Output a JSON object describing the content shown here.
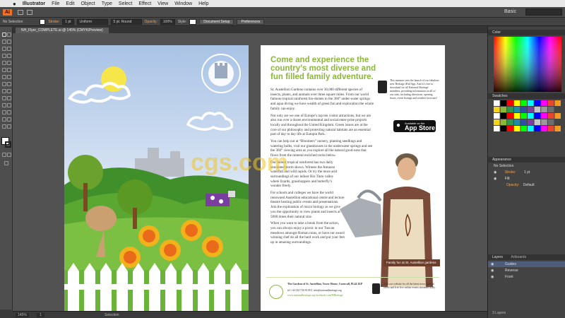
{
  "menu": {
    "app": "Illustrator",
    "items": [
      "File",
      "Edit",
      "Object",
      "Type",
      "Select",
      "Effect",
      "View",
      "Window",
      "Help"
    ]
  },
  "appbar": {
    "logo": "Ai",
    "workspace": "Basic"
  },
  "control": {
    "selection": "No Selection",
    "stroke_label": "Stroke:",
    "stroke_value": "1 pt",
    "stroke_style": "Uniform",
    "brush": "5 pt. Round",
    "opacity_label": "Opacity:",
    "opacity_value": "100%",
    "style_label": "Style:",
    "doc_setup": "Document Setup",
    "prefs": "Preferences"
  },
  "document": {
    "tab_title": "NH_Flyer_COMPLETE.ai @ 145% (CMYK/Preview)"
  },
  "flyer": {
    "headline": "Come and experience the country’s most diverse and fun filled family adventure.",
    "para1": "St. Austellion Gardens contains over 30,000 different species of insects, plants, and animals over three square miles. From our world famous tropical rainforest bio-domes to the 360° under-water springs and aqua diving we have wealth of green fun and exploration the whole family can enjoy.",
    "para2": "Not only are we one of Europe’s top ten visitor attractions, but we are also run over a dozen environmental and social enter-prise projects locally and throughout the United Kingdom. Green issues are at the core of our philosophy and protecting natural habitats are an essential part of day to day life at Eutopia Park.",
    "para3": "You can help out at “Bloomers” nursery, planting seedlings and watering bulbs, visit our glasshouses in the underwater springs and see the 360° viewing area as you explore all the natural good-ness that flows from the mineral enriched rocks below.",
    "para4": "Our indoor tropical rainforest has two daily simulated storm shows. Witness the Amazon waterfall and wild rapids. Or try the more arid surroundings of our indoor Rio Tinto valley where lizards, grasshoppers and butterfly’s wonder freely.",
    "para5": "For schools and colleges we have the world renowned Austellion educational centre and lecture theatre hosting public events and presentations. Join the exploration of micro biology as we give you the opportunity to view plants and insects at 5000 times their natural size.",
    "para6": "When you want to take a break from the action, you can always enjoy a picnic in our Tuscan meadows amongst Roman ruins, or have our award winning chef do all the hard work and put your feet up in amazing surroundings.",
    "app_promo": "This summer sees the launch of our fabulous new Heritage iPad App. And it’s free to download for all National Heritage members, providing information on all of our sites, including directions, opening hours, event listings and weather forecasts!",
    "appstore_small": "Available on the",
    "appstore_big": "App Store",
    "caption": "Family fun at St. Austellion gardens",
    "footer_address": "The Gardens of St. Austellion, Tower House, Cornwall, PL44 3EP",
    "footer_contact": "tel +44 (0)1726 811911  info@nationalheritage.org",
    "footer_web": "www.nationalheritage.org   facebook.com/NHeritage",
    "footer_right": "Visit our website for all the latest news, special offers and free live online events streamed daily.",
    "seal_text": "THE GARDENS OF ST. AUSTELLION"
  },
  "watermark": "cgs.com",
  "panels": {
    "color": "Color",
    "swatches": "Swatches",
    "appearance": "Appearance",
    "appearance_rows": [
      "No Selection",
      "Stroke:",
      "1 pt",
      "Fill:",
      "Opacity:",
      "Default"
    ],
    "layers_tab": "Layers",
    "artboards_tab": "Artboards",
    "layers": [
      "Guides",
      "Reverse",
      "Front"
    ],
    "layer_count": "3 Layers"
  },
  "status": {
    "zoom": "145%",
    "page": "1",
    "selection": "Selection"
  },
  "colors": {
    "accent": "#8cb63c",
    "ui": "#434343",
    "sky": "#a9c8e8",
    "grass": "#5aa832"
  }
}
